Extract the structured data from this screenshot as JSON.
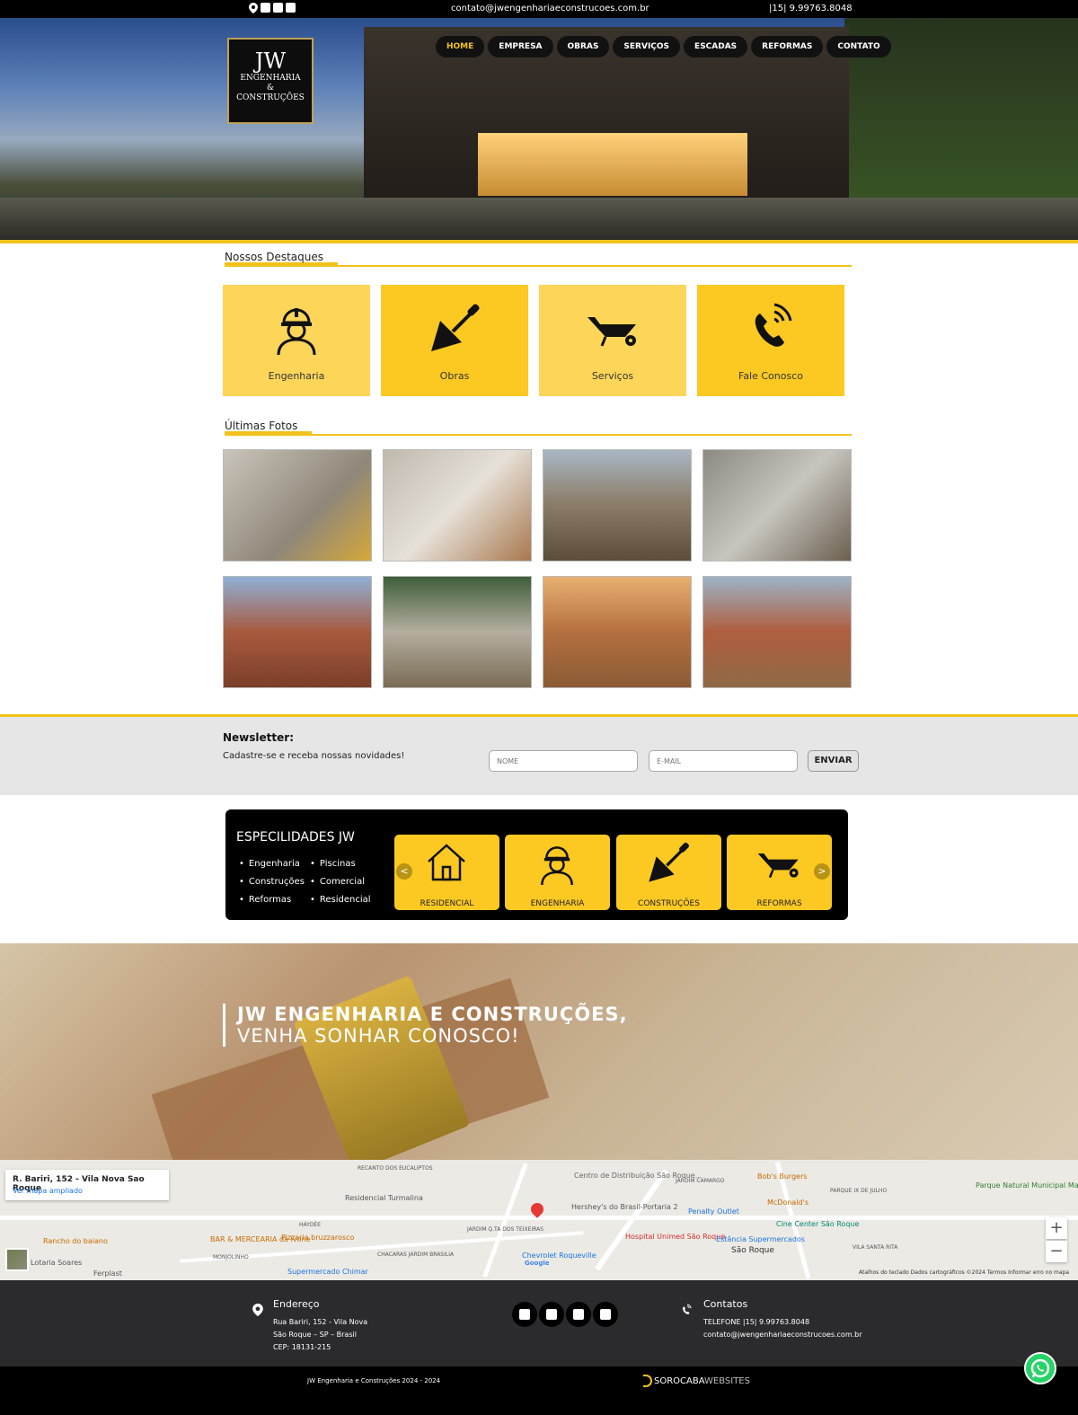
{
  "topbar": {
    "email": "contato@jwengenhariaeconstrucoes.com.br",
    "phone": "|15| 9.99763.8048",
    "social_icons": [
      "map-pin-icon",
      "facebook-icon",
      "instagram-icon",
      "linkedin-icon"
    ]
  },
  "logo": {
    "line1": "JW",
    "line2": "ENGENHARIA",
    "line3": "&",
    "line4": "CONSTRUÇÕES"
  },
  "nav": {
    "items": [
      "HOME",
      "EMPRESA",
      "OBRAS",
      "SERVIÇOS",
      "ESCADAS",
      "REFORMAS",
      "CONTATO"
    ],
    "active": "HOME",
    "active_color": "#f2c21b"
  },
  "highlights": {
    "heading": "Nossos Destaques",
    "cards": [
      {
        "label": "Engenharia",
        "icon": "engineer-icon"
      },
      {
        "label": "Obras",
        "icon": "trowel-icon"
      },
      {
        "label": "Serviços",
        "icon": "wheelbarrow-icon"
      },
      {
        "label": "Fale Conosco",
        "icon": "phone-icon"
      }
    ]
  },
  "photos": {
    "heading": "Últimas Fotos",
    "count": 8
  },
  "newsletter": {
    "title": "Newsletter:",
    "subtitle": "Cadastre-se e receba nossas novidades!",
    "name_placeholder": "NOME",
    "email_placeholder": "E-MAIL",
    "button": "ENVIAR"
  },
  "specialities": {
    "title": "ESPECILIDADES JW",
    "col1": [
      "Engenharia",
      "Construções",
      "Reformas"
    ],
    "col2": [
      "Piscinas",
      "Comercial",
      "Residencial"
    ],
    "tiles": [
      {
        "label": "RESIDENCIAL",
        "icon": "house-icon"
      },
      {
        "label": "ENGENHARIA",
        "icon": "engineer-icon"
      },
      {
        "label": "CONSTRUÇÕES",
        "icon": "trowel-icon"
      },
      {
        "label": "REFORMAS",
        "icon": "wheelbarrow-icon"
      }
    ],
    "prev": "<",
    "next": ">"
  },
  "banner": {
    "line1": "JW ENGENHARIA E CONSTRUÇÕES,",
    "line2": "VENHA SONHAR CONOSCO!"
  },
  "map": {
    "address": "R. Bariri, 152 - Vila Nova Sao Roque",
    "link": "Ver mapa ampliado",
    "zoom_in": "+",
    "zoom_out": "−",
    "attribution": "Atalhos do teclado    Dados cartográficos ©2024    Termos    Informar erro no mapa",
    "places": [
      "RECANTO DOS EUCALIPTOS",
      "Residencial Turmalina",
      "Centro de Distribuição São Roque...",
      "JARDIM CAMARGO",
      "Bob's Burgers",
      "Parque Natural Municipal Mata da Câmara",
      "McDonald's",
      "PARQUE IX DE JULHO",
      "Hershey's do Brasil-Portaria 2",
      "Penalty Outlet",
      "Cine Center São Roque",
      "Rancho do baiano",
      "HAYDÉE",
      "BAR & MERCEARIA da Ivone",
      "Pizzaria bruzzarosco",
      "JARDIM Q.TA DOS TEIXEIRAS",
      "Hospital Unimed São Roque",
      "Estância Supermercados",
      "São Roque",
      "VILA SANTA RITA",
      "MONJOLINHO",
      "CHACARAS JARDIM BRASILIA",
      "Chevrolet Roqueville",
      "Supermercado Chimar",
      "Ferplast",
      "Lotaria Soares",
      "Google"
    ]
  },
  "footer": {
    "address_title": "Endereço",
    "address_lines": [
      "Rua Bariri, 152 - Vila Nova",
      "São Roque – SP – Brasil",
      "CEP: 18131-215"
    ],
    "contacts_title": "Contatos",
    "contact_phone": "TELEFONE |15| 9.99763.8048",
    "contact_email": "contato@jwengenhariaeconstrucoes.com.br",
    "social_icons": [
      "email-icon",
      "facebook-icon",
      "instagram-icon",
      "linkedin-icon"
    ],
    "copyright": "JW Engenharia e Construções 2024 - 2024",
    "brand_part1": "SOROCABA",
    "brand_part2": "WEBSITES"
  },
  "colors": {
    "accent_yellow": "#f2c21b",
    "card_yellow": "#fcc923",
    "card_light_yellow": "#fdd659",
    "whatsapp": "#25d366"
  }
}
